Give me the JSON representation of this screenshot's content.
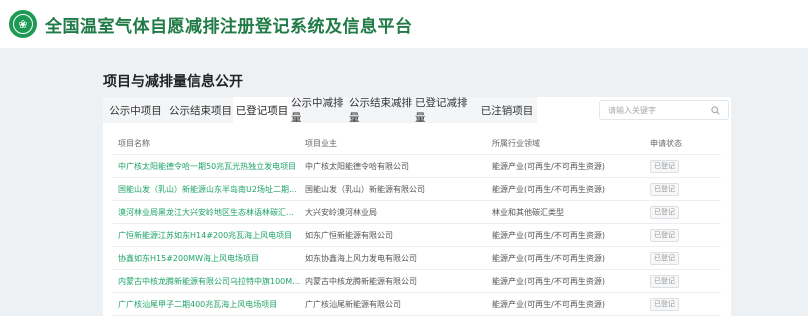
{
  "header": {
    "logo_icon": "emblem-icon",
    "title": "全国温室气体自愿减排注册登记系统及信息平台"
  },
  "section": {
    "title": "项目与减排量信息公开"
  },
  "tabs": [
    {
      "label": "公示中项目"
    },
    {
      "label": "公示结束项目"
    },
    {
      "label": "已登记项目",
      "active": true
    },
    {
      "label": "公示中减排量"
    },
    {
      "label": "公示结束减排量"
    },
    {
      "label": "已登记减排量"
    },
    {
      "label": "已注销项目"
    }
  ],
  "search": {
    "placeholder": "请输入关键字",
    "icon": "search-icon"
  },
  "table": {
    "headers": [
      "项目名称",
      "项目业主",
      "所属行业领域",
      "申请状态"
    ],
    "rows": [
      {
        "name": "中广核太阳能德令哈一期50兆瓦光热独立发电项目",
        "owner": "中广核太阳能德令哈有限公司",
        "field": "能源产业(可再生/不可再生资源)",
        "status": "已登记"
      },
      {
        "name": "国能山发（乳山）新能源山东半岛南U2场址二期297...",
        "owner": "国能山发（乳山）新能源有限公司",
        "field": "能源产业(可再生/不可再生资源)",
        "status": "已登记"
      },
      {
        "name": "漠河林业局黑龙江大兴安岭地区生态林语林碳汇项目",
        "owner": "大兴安岭漠河林业局",
        "field": "林业和其他碳汇类型",
        "status": "已登记"
      },
      {
        "name": "广恒新能源江苏如东H14#200兆瓦海上风电项目",
        "owner": "如东广恒新能源有限公司",
        "field": "能源产业(可再生/不可再生资源)",
        "status": "已登记"
      },
      {
        "name": "协鑫如东H15#200MW海上风电场项目",
        "owner": "如东协鑫海上风力发电有限公司",
        "field": "能源产业(可再生/不可再生资源)",
        "status": "已登记"
      },
      {
        "name": "内蒙古中核龙腾新能源有限公司乌拉特中旗100MW...",
        "owner": "内蒙古中核龙腾新能源有限公司",
        "field": "能源产业(可再生/不可再生资源)",
        "status": "已登记"
      },
      {
        "name": "广广核汕尾甲子二期400兆瓦海上风电场项目",
        "owner": "广广核汕尾新能源有限公司",
        "field": "能源产业(可再生/不可再生资源)",
        "status": "已登记"
      }
    ]
  },
  "colors": {
    "brand_green": "#1f7a45",
    "link_green": "#1fa36a"
  }
}
